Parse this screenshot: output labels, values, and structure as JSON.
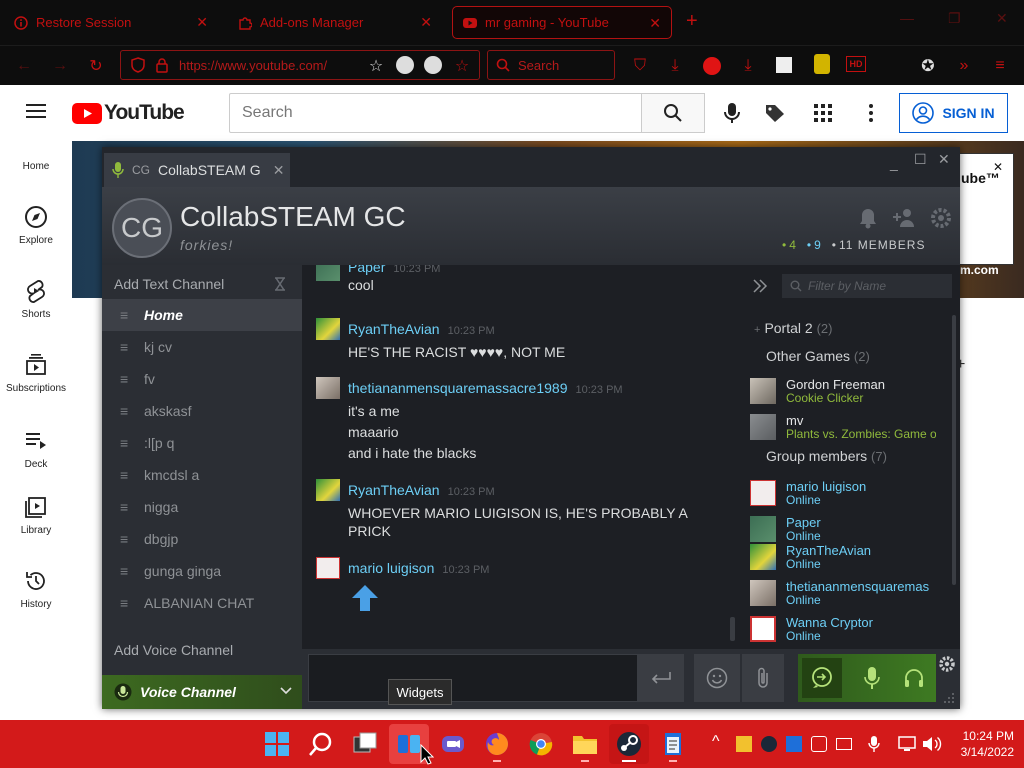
{
  "browser": {
    "tabs": [
      {
        "label": "Restore Session"
      },
      {
        "label": "Add-ons Manager"
      },
      {
        "label": "mr gaming - YouTube"
      }
    ],
    "url": "https://www.youtube.com/",
    "search_placeholder": "Search",
    "hd_label": "HD"
  },
  "youtube": {
    "logo_text": "YouTube",
    "search_placeholder": "Search",
    "signin_label": "SIGN IN",
    "sidebar": [
      {
        "label": "Home",
        "icon": "home-icon"
      },
      {
        "label": "Explore",
        "icon": "compass-icon"
      },
      {
        "label": "Shorts",
        "icon": "shorts-icon"
      },
      {
        "label": "Subscriptions",
        "icon": "subscriptions-icon"
      },
      {
        "label": "Deck",
        "icon": "deck-icon"
      },
      {
        "label": "Library",
        "icon": "library-icon"
      },
      {
        "label": "History",
        "icon": "history-icon"
      }
    ],
    "ad_text": "ube™",
    "ad_link": "m.com"
  },
  "steam": {
    "tab_initials": "CG",
    "tab_title": "CollabSTEAM G",
    "group_initials": "CG",
    "group_name": "CollabSTEAM GC",
    "group_tagline": "forkies!",
    "stats": {
      "ingame": "4",
      "online": "9",
      "members": "11 MEMBERS"
    },
    "add_text_channel": "Add Text Channel",
    "text_channels": [
      "Home",
      "kj cv",
      "fv",
      "akskasf",
      ":l[p q",
      "kmcdsl a",
      "nigga",
      "dbgjp",
      "gunga ginga",
      "ALBANIAN CHAT"
    ],
    "add_voice_channel": "Add Voice Channel",
    "voice_channel": "Voice Channel",
    "messages": [
      {
        "name": "Paper",
        "time": "10:23 PM",
        "lines": [
          "cool"
        ]
      },
      {
        "name": "RyanTheAvian",
        "time": "10:23 PM",
        "lines": [
          "HE'S THE RACIST ♥♥♥♥, NOT ME"
        ]
      },
      {
        "name": "thetiananmensquaremassacre1989",
        "time": "10:23 PM",
        "lines": [
          "it's a me",
          "maaario",
          "and i hate the blacks"
        ]
      },
      {
        "name": "RyanTheAvian",
        "time": "10:23 PM",
        "lines": [
          "WHOEVER MARIO LUIGISON IS, HE'S PROBABLY A",
          "PRICK"
        ]
      },
      {
        "name": "mario luigison",
        "time": "10:23 PM",
        "lines": []
      }
    ],
    "filter_placeholder": "Filter by Name",
    "groups": {
      "portal": {
        "label": "Portal 2",
        "count": "(2)"
      },
      "other": {
        "label": "Other Games",
        "count": "(2)"
      },
      "members": {
        "label": "Group members",
        "count": "(7)"
      }
    },
    "ingame_members": [
      {
        "name": "Gordon Freeman",
        "status": "Cookie Clicker"
      },
      {
        "name": "mv",
        "status": "Plants vs. Zombies: Game o"
      }
    ],
    "online_members": [
      {
        "name": "mario luigison",
        "status": "Online"
      },
      {
        "name": "Paper",
        "status": "Online"
      },
      {
        "name": "RyanTheAvian",
        "status": "Online"
      },
      {
        "name": "thetiananmensquaremas",
        "status": "Online"
      },
      {
        "name": "Wanna Cryptor",
        "status": "Online"
      }
    ],
    "colors": {
      "ingame": "#90ba3c",
      "online": "#6dcff6",
      "voice": "#3d6a20"
    }
  },
  "taskbar": {
    "tooltip": "Widgets",
    "time": "10:24 PM",
    "date": "3/14/2022"
  }
}
